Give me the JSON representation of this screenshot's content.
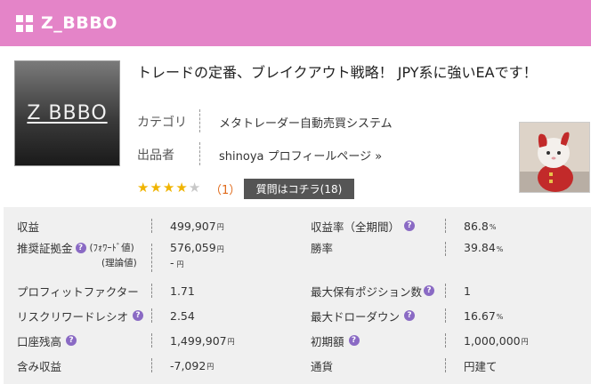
{
  "header": {
    "title": "Z_BBBO"
  },
  "logo": {
    "text": "Z BBBO"
  },
  "product": {
    "title": "トレードの定番、ブレイクアウト戦略！ JPY系に強いEAです！",
    "category_label": "カテゴリ",
    "category_value": "メタトレーダー自動売買システム",
    "seller_label": "出品者",
    "seller_value": "shinoya プロフィールページ »"
  },
  "rating": {
    "stars": 4,
    "max_stars": 5,
    "review_count": "（1）"
  },
  "question_button": "質問はコチラ(18)",
  "stats": {
    "profit_label": "収益",
    "profit_value": "499,907",
    "profit_rate_label": "収益率（全期間）",
    "profit_rate_value": "86.8",
    "margin_label": "推奨証拠金",
    "margin_forward_label": "(ﾌｫﾜｰﾄﾞ値)",
    "margin_theory_label": "(理論値)",
    "margin_forward_value": "576,059",
    "margin_theory_value": "-",
    "winrate_label": "勝率",
    "winrate_value": "39.84",
    "pf_label": "プロフィットファクター",
    "pf_value": "1.71",
    "max_positions_label": "最大保有ポジション数",
    "max_positions_value": "1",
    "rr_label": "リスクリワードレシオ",
    "rr_value": "2.54",
    "dd_label": "最大ドローダウン",
    "dd_value": "16.67",
    "balance_label": "口座残高",
    "balance_value": "1,499,907",
    "initial_label": "初期額",
    "initial_value": "1,000,000",
    "unrealized_label": "含み収益",
    "unrealized_value": "-7,092",
    "currency_label": "通貨",
    "currency_value": "円建て",
    "yen_unit": "円",
    "percent_unit": "%",
    "help_glyph": "?"
  },
  "icons": {
    "header": "grid-icon",
    "help": "question-circle-icon",
    "star": "star-icon"
  },
  "colors": {
    "header_bg": "#e484c8",
    "help_bg": "#8a6ac4",
    "star": "#f0b400",
    "review_count": "#e06a1a",
    "button_bg": "#555555",
    "stats_bg": "#f0f0f0"
  }
}
